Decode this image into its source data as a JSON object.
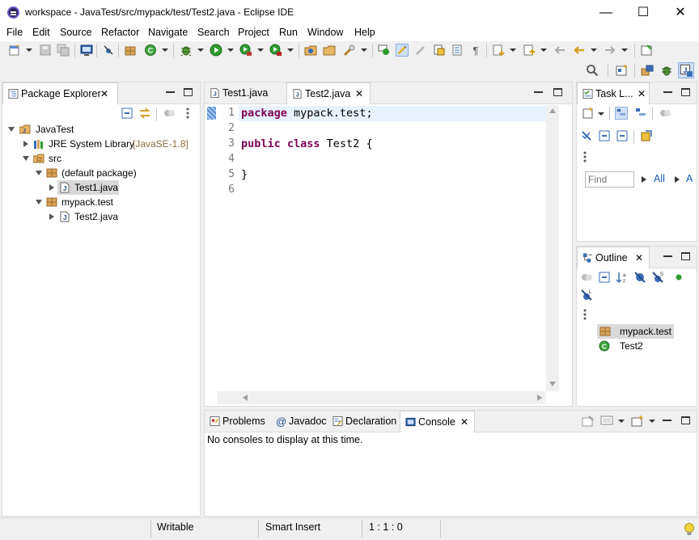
{
  "window": {
    "title": "workspace - JavaTest/src/mypack/test/Test2.java - Eclipse IDE",
    "minimize": "—",
    "maximize": "☐",
    "close": "✕"
  },
  "menu": [
    "File",
    "Edit",
    "Source",
    "Refactor",
    "Navigate",
    "Search",
    "Project",
    "Run",
    "Window",
    "Help"
  ],
  "package_explorer": {
    "tab_label": "Package Explorer",
    "tree": [
      {
        "label": "JavaTest",
        "icon": "java-project-icon"
      },
      {
        "label": "JRE System Library",
        "suffix": "[JavaSE-1.8]",
        "icon": "library-icon"
      },
      {
        "label": "src",
        "icon": "source-folder-icon"
      },
      {
        "label": "(default package)",
        "icon": "package-icon"
      },
      {
        "label": "Test1.java",
        "icon": "java-file-icon",
        "selected": true
      },
      {
        "label": "mypack.test",
        "icon": "package-icon"
      },
      {
        "label": "Test2.java",
        "icon": "java-file-icon"
      }
    ]
  },
  "editor": {
    "tabs": [
      {
        "label": "Test1.java",
        "active": false
      },
      {
        "label": "Test2.java",
        "active": true
      }
    ],
    "line_numbers": [
      "1",
      "2",
      "3",
      "4",
      "5",
      "6"
    ],
    "lines": [
      {
        "kw": "package",
        "rest": " mypack.test;"
      },
      {
        "kw": "",
        "rest": ""
      },
      {
        "kw": "public class",
        "rest": " Test2 {"
      },
      {
        "kw": "",
        "rest": ""
      },
      {
        "kw": "",
        "rest": "}"
      },
      {
        "kw": "",
        "rest": ""
      }
    ]
  },
  "task_list": {
    "tab_label": "Task L...",
    "find_placeholder": "Find",
    "all_label": "All",
    "a_label": "A"
  },
  "outline": {
    "tab_label": "Outline",
    "items": [
      {
        "label": "mypack.test",
        "icon": "package-icon"
      },
      {
        "label": "Test2",
        "icon": "class-icon"
      }
    ]
  },
  "bottom": {
    "tabs": [
      "Problems",
      "Javadoc",
      "Declaration",
      "Console"
    ],
    "active_tab": "Console",
    "message": "No consoles to display at this time."
  },
  "status": {
    "writable": "Writable",
    "insert_mode": "Smart Insert",
    "position": "1 : 1 : 0"
  },
  "colors": {
    "keyword": "#7f0055",
    "current_line": "#e8f2fe",
    "selection": "#d9d9d9"
  }
}
